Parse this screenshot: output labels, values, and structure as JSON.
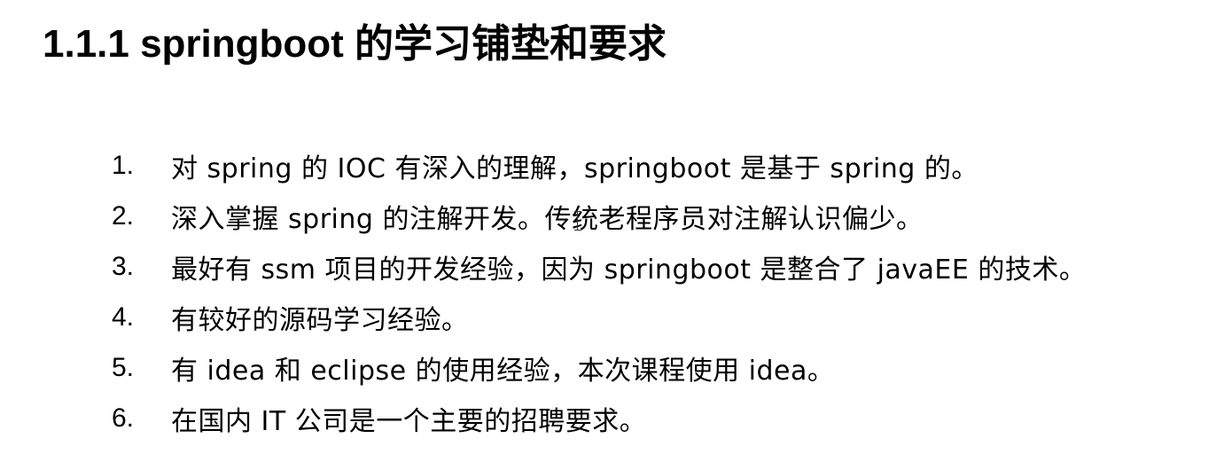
{
  "heading": "1.1.1 springboot 的学习铺垫和要求",
  "items": [
    {
      "num": "1.",
      "text": "对 spring 的 IOC 有深入的理解，springboot 是基于 spring 的。"
    },
    {
      "num": "2.",
      "text": "深入掌握 spring 的注解开发。传统老程序员对注解认识偏少。"
    },
    {
      "num": "3.",
      "text": "最好有 ssm 项目的开发经验，因为 springboot 是整合了 javaEE 的技术。"
    },
    {
      "num": "4.",
      "text": "有较好的源码学习经验。"
    },
    {
      "num": "5.",
      "text": "有 idea 和 eclipse 的使用经验，本次课程使用 idea。"
    },
    {
      "num": "6.",
      "text": "在国内 IT 公司是一个主要的招聘要求。"
    }
  ]
}
